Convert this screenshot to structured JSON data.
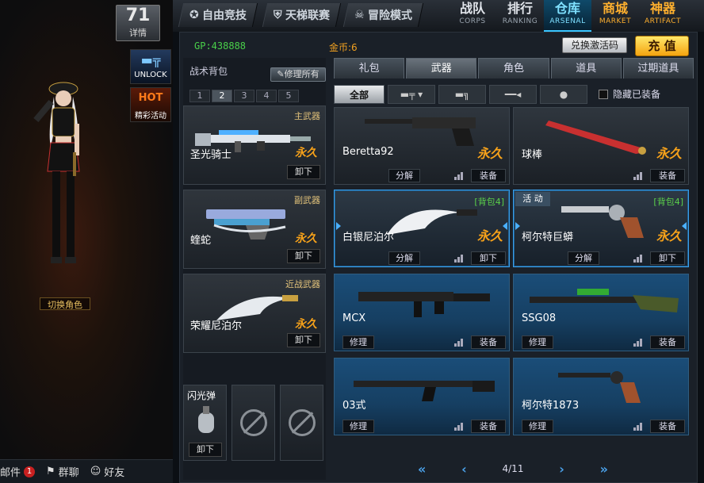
{
  "level": {
    "number": "71",
    "label": "详情"
  },
  "side_badges": {
    "unlock": "UNLOCK",
    "hot_top": "HOT",
    "hot": "精彩活动"
  },
  "switch_role": "切换角色",
  "left_bottom": {
    "mail": "邮件",
    "mail_count": "1",
    "group_chat": "群聊",
    "friends": "好友"
  },
  "mode_tabs": [
    "自由竞技",
    "天梯联赛",
    "冒险模式"
  ],
  "main_nav": [
    {
      "cn": "战队",
      "en": "CORPS"
    },
    {
      "cn": "排行",
      "en": "RANKING"
    },
    {
      "cn": "仓库",
      "en": "ARSENAL"
    },
    {
      "cn": "商城",
      "en": "MARKET"
    },
    {
      "cn": "神器",
      "en": "ARTIFACT"
    }
  ],
  "currency": {
    "gp": "GP:438888",
    "gold": "金币:6"
  },
  "buttons": {
    "redeem": "兑换激活码",
    "recharge": "充 值",
    "repair_all": "修理所有"
  },
  "bag": {
    "title": "战术背包",
    "pages": [
      "1",
      "2",
      "3",
      "4",
      "5"
    ],
    "active_page": "2",
    "primary": {
      "cat": "主武器",
      "name": "圣光骑士",
      "perm": "永久",
      "btn": "卸下"
    },
    "secondary": {
      "cat": "副武器",
      "name": "蝰蛇",
      "perm": "永久",
      "btn": "卸下"
    },
    "melee": {
      "cat": "近战武器",
      "name": "荣耀尼泊尔",
      "perm": "永久",
      "btn": "卸下"
    },
    "throw": {
      "name": "闪光弹",
      "btn": "卸下"
    }
  },
  "tabs": [
    "礼包",
    "武器",
    "角色",
    "道具",
    "过期道具"
  ],
  "active_tab": "武器",
  "filters": {
    "all": "全部"
  },
  "hide_equipped": "隐藏已装备",
  "cards": [
    {
      "name": "Beretta92",
      "perm": "永久",
      "left_btn": "分解",
      "right_btn": "装备"
    },
    {
      "name": "球棒",
      "perm": "永久",
      "left_btn": "",
      "right_btn": "装备"
    },
    {
      "name": "白银尼泊尔",
      "perm": "永久",
      "tag": "[背包4]",
      "left_btn": "分解",
      "right_btn": "卸下"
    },
    {
      "name": "柯尔特巨蟒",
      "perm": "永久",
      "tag": "[背包4]",
      "activity": "活 动",
      "left_btn": "分解",
      "right_btn": "卸下"
    },
    {
      "name": "MCX",
      "left_btn": "修理",
      "right_btn": "装备"
    },
    {
      "name": "SSG08",
      "left_btn": "修理",
      "right_btn": "装备"
    },
    {
      "name": "03式",
      "left_btn": "修理",
      "right_btn": "装备"
    },
    {
      "name": "柯尔特1873",
      "left_btn": "修理",
      "right_btn": "装备"
    }
  ],
  "pager": {
    "text": "4/11"
  },
  "colors": {
    "accent": "#39c5ff",
    "gold": "#f7a21a",
    "gp": "#49d04a",
    "bag_tag": "#5ad04a"
  }
}
